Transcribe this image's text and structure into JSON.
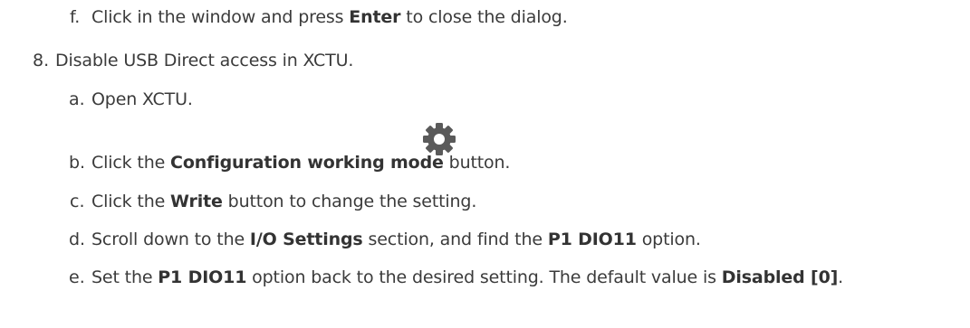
{
  "step_f": {
    "marker": "f.",
    "pre": "Click in the window and press ",
    "bold": "Enter",
    "post": " to close the dialog."
  },
  "step_8": {
    "marker": "8.",
    "text": "Disable USB Direct access in XCTU."
  },
  "step_a": {
    "marker": "a.",
    "text": "Open XCTU."
  },
  "step_b": {
    "marker": "b.",
    "pre": "Click the ",
    "bold": "Configuration working mode",
    "post": " button."
  },
  "gear_icon": {
    "icon": "gear-icon",
    "color": "#5a5a5a"
  },
  "step_c": {
    "marker": "c.",
    "pre": "Click the ",
    "bold": "Write",
    "post": " button to change the setting."
  },
  "step_d": {
    "marker": "d.",
    "pre": "Scroll down to the ",
    "bold1": "I/O Settings",
    "mid": " section, and find the ",
    "bold2": "P1 DIO11",
    "post": " option."
  },
  "step_e": {
    "marker": "e.",
    "pre": "Set the ",
    "bold1": "P1 DIO11",
    "mid": " option back to the desired setting. The default value is ",
    "bold2": "Disabled [0]",
    "post": "."
  }
}
